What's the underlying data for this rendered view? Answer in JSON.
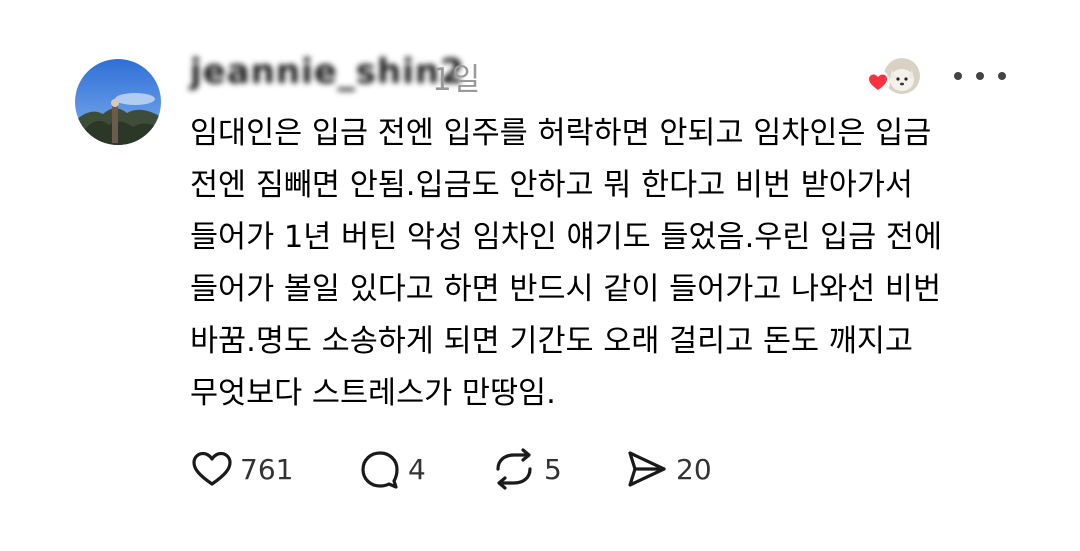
{
  "post": {
    "username": "jeannie_shin2",
    "timestamp": "1일",
    "body_lines": [
      "임대인은 입금 전엔 입주를 허락하면 안되고 임차인은 입금",
      "전엔 짐빼면 안됨.입금도 안하고 뭐 한다고 비번 받아가서",
      "들어가 1년 버틴 악성 임차인 얘기도 들었음.우린 입금 전에",
      "들어가 볼일 있다고 하면 반드시 같이 들어가고 나와선 비번",
      "바꿈.명도 소송하게 되면 기간도 오래 걸리고 돈도 깨지고",
      "무엇보다 스트레스가 만땅임."
    ]
  },
  "actions": {
    "like_count": "761",
    "reply_count": "4",
    "repost_count": "5",
    "share_count": "20"
  },
  "icons": {
    "like": "heart-outline-icon",
    "reply": "speech-bubble-icon",
    "repost": "repost-arrows-icon",
    "share": "send-arrow-icon",
    "liked_by": "red-heart-icon",
    "more": "more-dots-icon"
  },
  "colors": {
    "liked_heart": "#ff3040",
    "timestamp": "#9a9a9a",
    "icon": "#1a1a1a"
  }
}
